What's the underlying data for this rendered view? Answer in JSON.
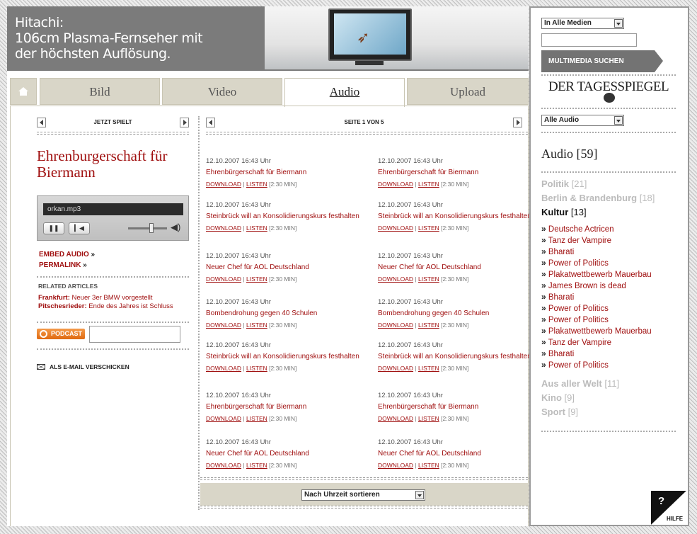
{
  "banner": {
    "line1": "Hitachi:",
    "line2": "106cm Plasma-Fernseher mit",
    "line3": "der höchsten Auflösung."
  },
  "tabs": [
    {
      "label": "Bild"
    },
    {
      "label": "Video"
    },
    {
      "label": "Audio"
    },
    {
      "label": "Upload"
    }
  ],
  "nowplaying": {
    "nav_title": "JETZT SPIELT",
    "title": "Ehrenburgerschaft für Biermann",
    "filename": "orkan.mp3",
    "embed": "EMBED AUDIO",
    "permalink": "PERMALINK",
    "related_heading": "RELATED ARTICLES",
    "related": [
      {
        "place": "Frankfurt:",
        "text": "Neuer 3er BMW vorgestellt"
      },
      {
        "place": "Pitschesrieder:",
        "text": "Ende des Jahres ist Schluss"
      }
    ],
    "podcast": "PODCAST",
    "email": "ALS E-MAIL VERSCHICKEN"
  },
  "list": {
    "nav_title": "SEITE 1 VON 5",
    "download": "DOWNLOAD",
    "listen": "LISTEN",
    "items": [
      {
        "date": "12.10.2007 16:43 Uhr",
        "title": "Ehrenbürgerschaft für Biermann",
        "dur": "[2:30 MIN]"
      },
      {
        "date": "12.10.2007 16:43 Uhr",
        "title": "Ehrenbürgerschaft für Biermann",
        "dur": "[2:30 MIN]"
      },
      {
        "date": "12.10.2007 16:43 Uhr",
        "title": "Steinbrück will an Konsolidierungskurs festhalten",
        "dur": "[2:30 MIN]"
      },
      {
        "date": "12.10.2007 16:43 Uhr",
        "title": "Steinbrück will an Konsolidierungskurs festhalten",
        "dur": "[2:30 MIN]"
      },
      {
        "date": "12.10.2007 16:43 Uhr",
        "title": "Neuer Chef für AOL Deutschland",
        "dur": "[2:30 MIN]"
      },
      {
        "date": "12.10.2007 16:43 Uhr",
        "title": "Neuer Chef für AOL Deutschland",
        "dur": "[2:30 MIN]"
      },
      {
        "date": "12.10.2007 16:43 Uhr",
        "title": "Bombendrohung gegen 40 Schulen",
        "dur": "[2:30 MIN]"
      },
      {
        "date": "12.10.2007 16:43 Uhr",
        "title": "Bombendrohung gegen 40 Schulen",
        "dur": "[2:30 MIN]"
      },
      {
        "date": "12.10.2007 16:43 Uhr",
        "title": "Steinbrück will an Konsolidierungskurs festhalten",
        "dur": "[2:30 MIN]"
      },
      {
        "date": "12.10.2007 16:43 Uhr",
        "title": "Steinbrück will an Konsolidierungskurs festhalten",
        "dur": "[2:30 MIN]"
      },
      {
        "date": "12.10.2007 16:43 Uhr",
        "title": "Ehrenbürgerschaft für Biermann",
        "dur": "[2:30 MIN]"
      },
      {
        "date": "12.10.2007 16:43 Uhr",
        "title": "Ehrenbürgerschaft für Biermann",
        "dur": "[2:30 MIN]"
      },
      {
        "date": "12.10.2007 16:43 Uhr",
        "title": "Neuer Chef für AOL Deutschland",
        "dur": "[2:30 MIN]"
      },
      {
        "date": "12.10.2007 16:43 Uhr",
        "title": "Neuer Chef für AOL Deutschland",
        "dur": "[2:30 MIN]"
      }
    ],
    "sort": "Nach Uhrzeit sortieren"
  },
  "right": {
    "media_select": "In Alle Medien",
    "search_button": "MULTIMEDIA SUCHEN",
    "logo": "DER TAGESSPIEGEL",
    "audio_select": "Alle Audio",
    "section_title": "Audio [59]",
    "cats_top": [
      {
        "name": "Politik",
        "count": "[21]"
      },
      {
        "name": "Berlin & Brandenburg",
        "count": "[18]"
      }
    ],
    "active_cat": {
      "name": "Kultur",
      "count": "[13]"
    },
    "sub": [
      "Deutsche Actricen",
      "Tanz der Vampire",
      "Bharati",
      "Power of Politics",
      "Plakatwettbewerb Mauerbau",
      "James Brown is dead",
      "Bharati",
      "Power of Politics",
      "Power of Politics",
      "Plakatwettbewerb Mauerbau",
      "Tanz der Vampire",
      "Bharati",
      "Power of Politics"
    ],
    "cats_bottom": [
      {
        "name": "Aus aller Welt",
        "count": "[11]"
      },
      {
        "name": "Kino",
        "count": "[9]"
      },
      {
        "name": "Sport",
        "count": "[9]"
      }
    ],
    "help": "HILFE"
  }
}
